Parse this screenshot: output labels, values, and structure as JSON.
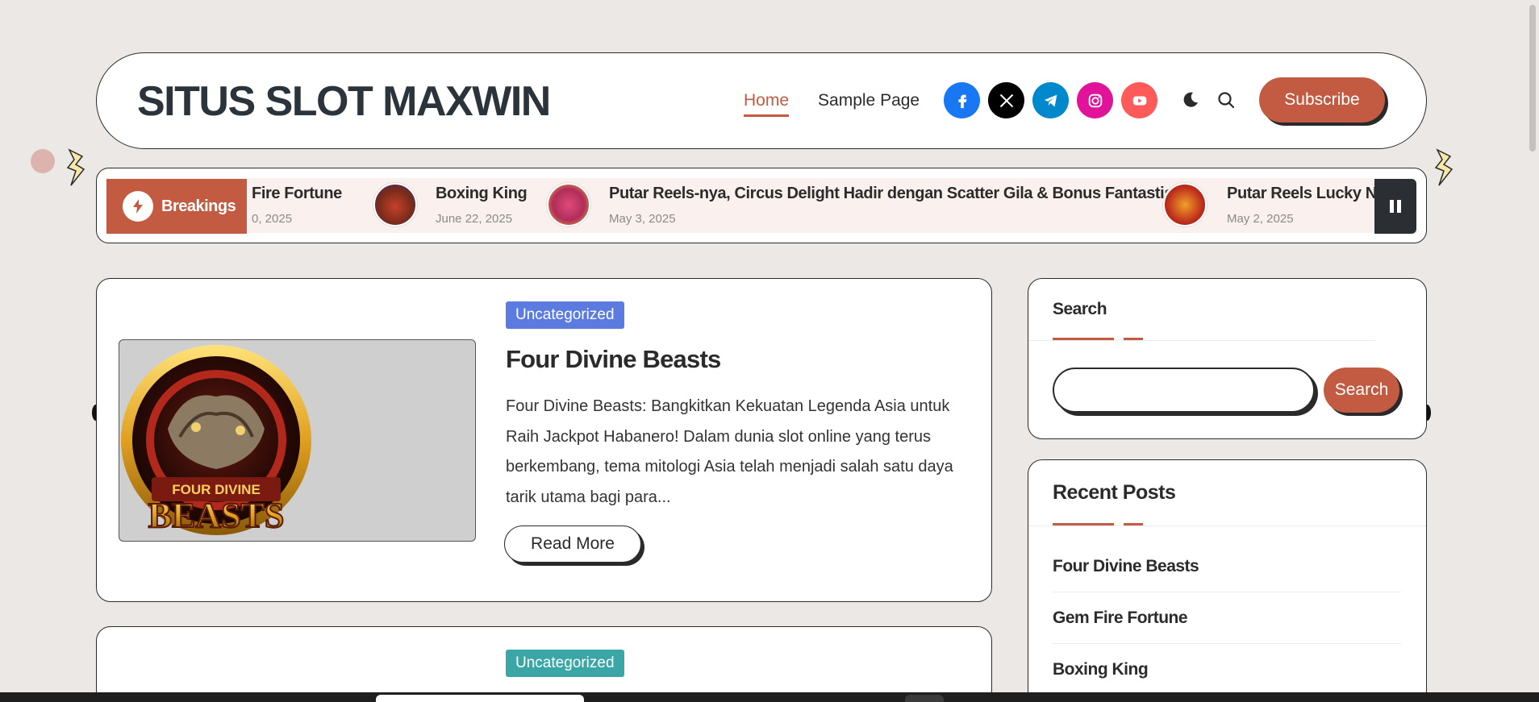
{
  "header": {
    "site_title": "SITUS SLOT MAXWIN",
    "nav": [
      {
        "label": "Home",
        "active": true
      },
      {
        "label": "Sample Page",
        "active": false
      }
    ],
    "socials": [
      {
        "icon": "facebook-icon",
        "color": "#1877f2"
      },
      {
        "icon": "x-icon",
        "color": "#000000"
      },
      {
        "icon": "telegram-icon",
        "color": "#0088cc"
      },
      {
        "icon": "instagram-icon",
        "color": "#e1139a"
      },
      {
        "icon": "youtube-icon",
        "color": "#ff5a5a"
      }
    ],
    "subscribe_label": "Subscribe"
  },
  "ticker": {
    "label": "Breakings",
    "items": [
      {
        "title": "Fire Fortune",
        "date": "0, 2025"
      },
      {
        "title": "Boxing King",
        "date": "June 22, 2025"
      },
      {
        "title": "Putar Reels-nya, Circus Delight Hadir dengan Scatter Gila & Bonus Fantastis",
        "date": "May 3, 2025"
      },
      {
        "title": "Putar Reels Lucky Ne",
        "date": "May 2, 2025"
      }
    ]
  },
  "posts": [
    {
      "category": "Uncategorized",
      "category_color": "#5b7be0",
      "title": "Four Divine Beasts",
      "excerpt": "Four Divine Beasts: Bangkitkan Kekuatan Legenda Asia untuk Raih Jackpot Habanero! Dalam dunia slot online yang terus berkembang, tema mitologi Asia telah menjadi salah satu daya tarik utama bagi para...",
      "read_more": "Read More",
      "image_text": "FOUR DIVINE BEASTS"
    },
    {
      "category": "Uncategorized",
      "category_color": "#3aa6a6"
    }
  ],
  "sidebar": {
    "search": {
      "title": "Search",
      "button_label": "Search",
      "value": ""
    },
    "recent": {
      "title": "Recent Posts",
      "items": [
        "Four Divine Beasts",
        "Gem Fire Fortune",
        "Boxing King"
      ]
    }
  },
  "colors": {
    "accent": "#c25b41",
    "background": "#ece8e5",
    "dark": "#2b2f33"
  }
}
